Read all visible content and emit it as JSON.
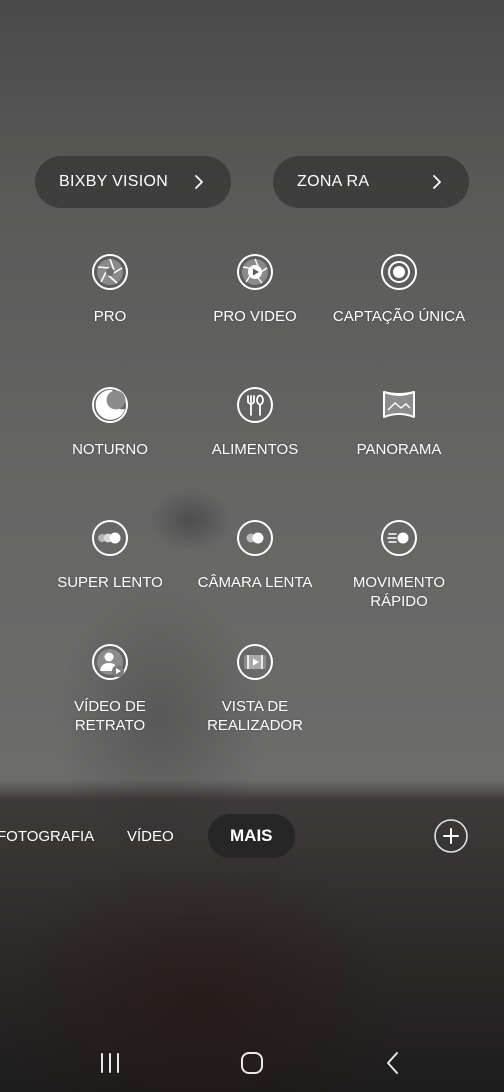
{
  "quick_buttons": {
    "bixby_vision": "BIXBY VISION",
    "zona_ra": "ZONA RA"
  },
  "modes": {
    "pro": "PRO",
    "pro_video": "PRO VIDEO",
    "captacao_unica": "CAPTAÇÃO ÚNICA",
    "noturno": "NOTURNO",
    "alimentos": "ALIMENTOS",
    "panorama": "PANORAMA",
    "super_lento": "SUPER LENTO",
    "camara_lenta": "CÂMARA LENTA",
    "movimento_rapido": "MOVIMENTO\nRÁPIDO",
    "video_de_retrato": "VÍDEO DE\nRETRATO",
    "vista_de_realizador": "VISTA DE\nREALIZADOR"
  },
  "bottom_tabs": {
    "fotografia": "FOTOGRAFIA",
    "video": "VÍDEO",
    "mais": "MAIS",
    "active": "MAIS"
  },
  "icons": {
    "bixby_chevron": "chevron-right-icon",
    "zona_chevron": "chevron-right-icon",
    "pro": "aperture-icon",
    "pro_video": "aperture-play-icon",
    "captacao_unica": "single-take-icon",
    "noturno": "moon-icon",
    "alimentos": "fork-knife-icon",
    "panorama": "panorama-icon",
    "super_lento": "super-slow-icon",
    "camara_lenta": "slow-motion-icon",
    "movimento_rapido": "hyperlapse-icon",
    "video_de_retrato": "portrait-video-icon",
    "vista_de_realizador": "directors-view-icon",
    "add": "plus-icon",
    "nav_recents": "recents-icon",
    "nav_home": "home-icon",
    "nav_back": "back-icon"
  },
  "colors": {
    "pill_background": "#3a3a3a",
    "active_tab_background": "#262626",
    "icon_white": "#ffffff"
  }
}
